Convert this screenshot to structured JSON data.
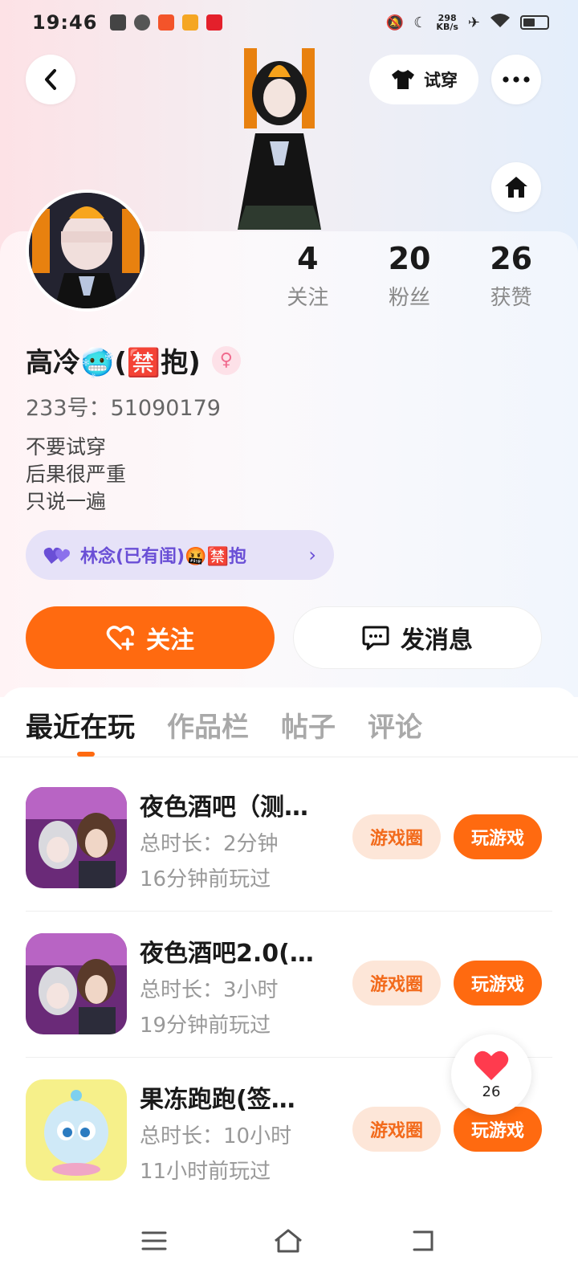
{
  "status_bar": {
    "time": "19:46",
    "speed_value": "298",
    "speed_unit": "KB/s"
  },
  "header": {
    "try_on_label": "试穿"
  },
  "profile": {
    "stats": [
      {
        "value": "4",
        "label": "关注"
      },
      {
        "value": "20",
        "label": "粉丝"
      },
      {
        "value": "26",
        "label": "获赞"
      }
    ],
    "name": "高冷🥶(🈲抱)",
    "gender_symbol": "♀",
    "id_line": "233号：51090179",
    "bio": [
      "不要试穿",
      "后果很严重",
      "只说一遍"
    ],
    "couple_label": "林念(已有闺)🤬🈲抱"
  },
  "actions": {
    "follow_label": "关注",
    "message_label": "发消息"
  },
  "tabs": [
    "最近在玩",
    "作品栏",
    "帖子",
    "评论"
  ],
  "games": [
    {
      "title": "夜色酒吧（测…",
      "duration": "总时长：2分钟",
      "last_played": "16分钟前玩过",
      "circle_label": "游戏圈",
      "play_label": "玩游戏"
    },
    {
      "title": "夜色酒吧2.0(…",
      "duration": "总时长：3小时",
      "last_played": "19分钟前玩过",
      "circle_label": "游戏圈",
      "play_label": "玩游戏"
    },
    {
      "title": "果冻跑跑(签…",
      "duration": "总时长：10小时",
      "last_played": "11小时前玩过",
      "circle_label": "游戏圈",
      "play_label": "玩游戏"
    }
  ],
  "like_float": {
    "count": "26"
  },
  "colors": {
    "accent": "#ff6a10",
    "accent_light": "#fde6d8",
    "couple_purple": "#6a4fd6"
  }
}
